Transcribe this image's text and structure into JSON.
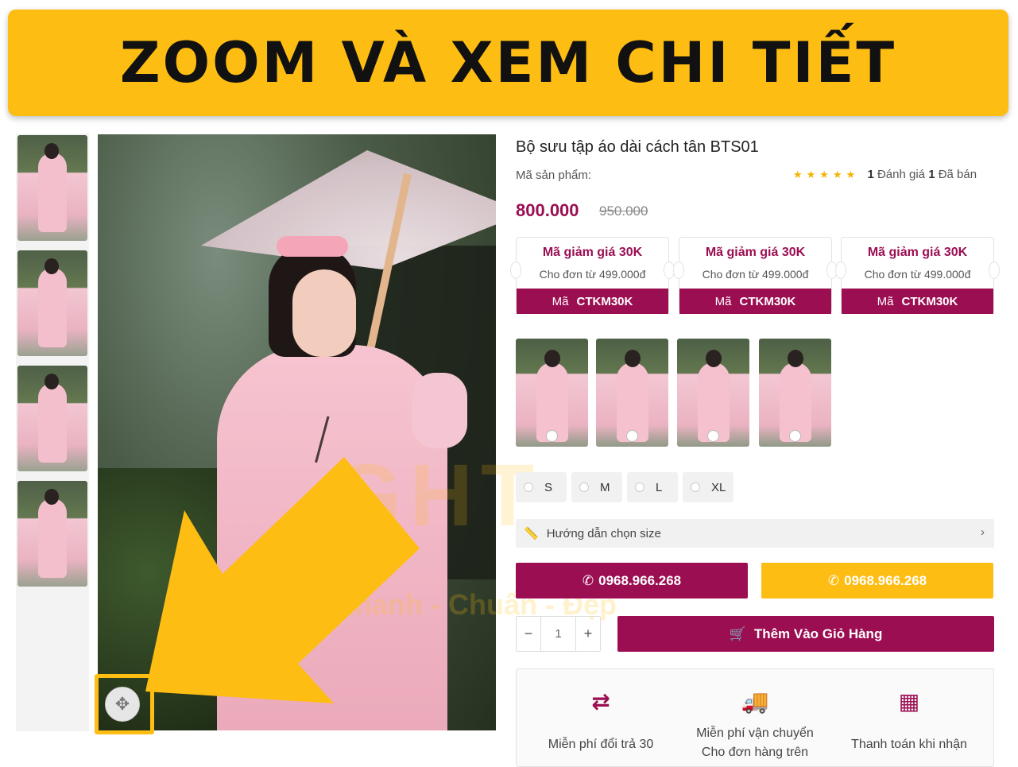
{
  "banner": {
    "title": "ZOOM VÀ XEM CHI TIẾT"
  },
  "product": {
    "title": "Bộ sưu tập áo dài cách tân BTS01",
    "sku_label": "Mã sản phẩm:",
    "rating": {
      "stars": "★★★★★",
      "review_count": "1",
      "review_label": "Đánh giá",
      "sold_count": "1",
      "sold_label": "Đã bán"
    },
    "price": "800.000",
    "old_price": "950.000"
  },
  "coupons": [
    {
      "title": "Mã giảm giá 30K",
      "desc": "Cho đơn từ 499.000đ",
      "code_label": "Mã",
      "code": "CTKM30K"
    },
    {
      "title": "Mã giảm giá 30K",
      "desc": "Cho đơn từ 499.000đ",
      "code_label": "Mã",
      "code": "CTKM30K"
    },
    {
      "title": "Mã giảm giá 30K",
      "desc": "Cho đơn từ 499.000đ",
      "code_label": "Mã",
      "code": "CTKM30K"
    }
  ],
  "sizes": [
    "S",
    "M",
    "L",
    "XL"
  ],
  "size_guide": {
    "label": "Hướng dẫn chọn size",
    "icon": "ruler-icon"
  },
  "buttons": {
    "phone_primary": "0968.966.268",
    "phone_secondary": "0968.966.268",
    "add_to_cart": "Thêm Vào Giỏ Hàng"
  },
  "quantity": {
    "value": "1",
    "minus": "−",
    "plus": "+"
  },
  "features": [
    {
      "icon": "exchange-icon",
      "line1": "Miễn phí đổi trả 30",
      "line2": ""
    },
    {
      "icon": "truck-icon",
      "line1": "Miễn phí vận chuyển",
      "line2": "Cho đơn hàng trên"
    },
    {
      "icon": "qr-icon",
      "line1": "Thanh toán khi nhận",
      "line2": ""
    }
  ],
  "watermark": {
    "brand": "GHT",
    "slogan": "Nhanh - Chuẩn - Đẹp"
  },
  "colors": {
    "brand": "#9b0e52",
    "accent": "#fdbd12"
  }
}
